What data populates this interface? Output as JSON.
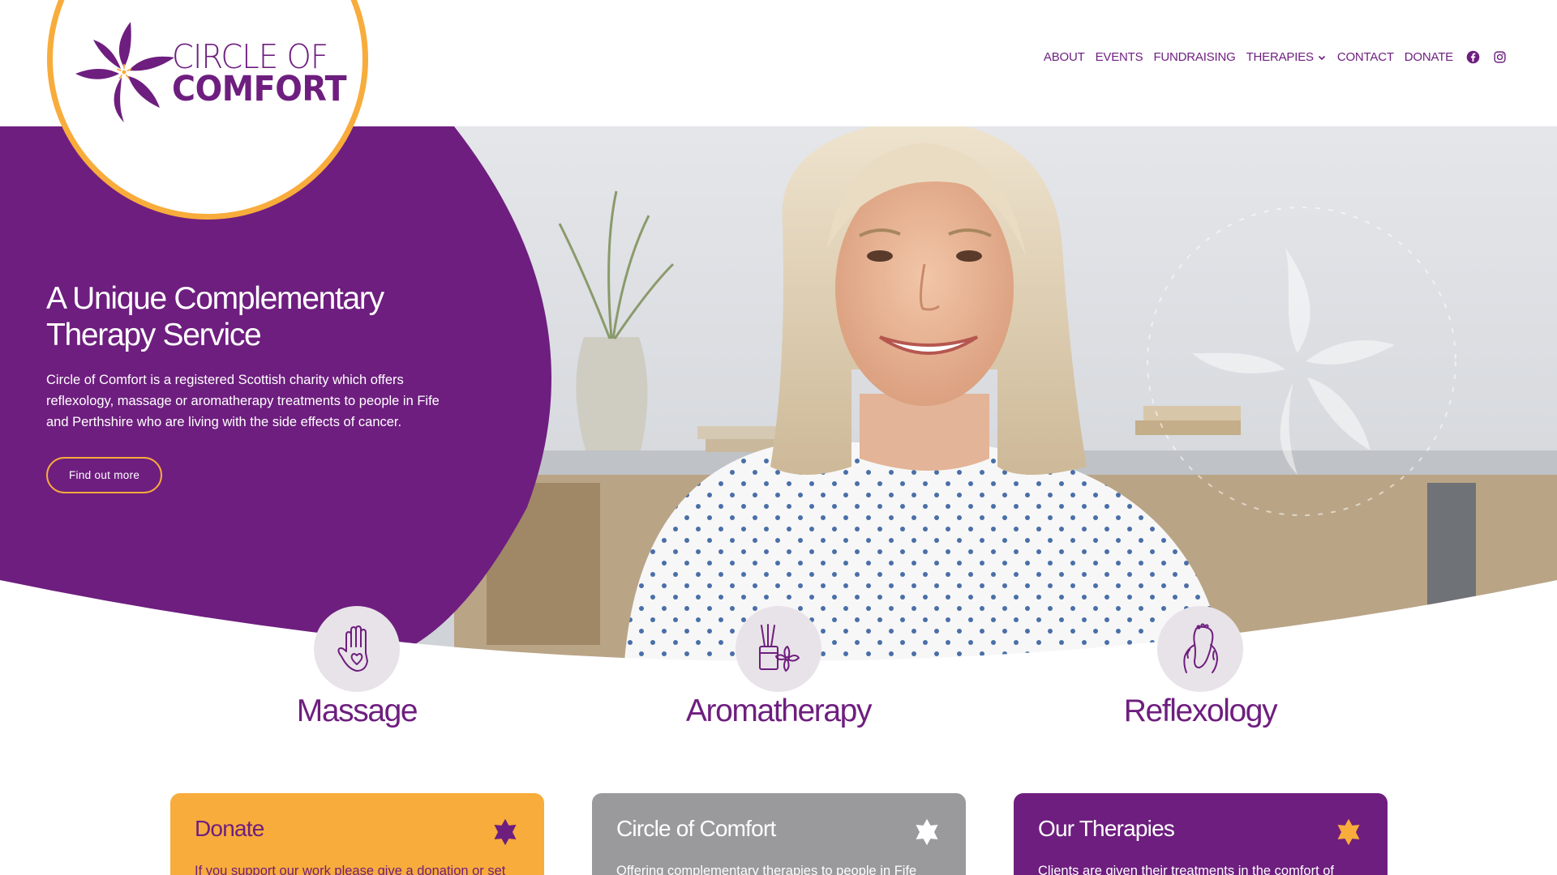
{
  "brand": {
    "line1": "CIRCLE OF",
    "line2": "COMFORT",
    "watermark_text": "CIRCLE OF COMFORT",
    "colors": {
      "purple": "#6e1e7f",
      "orange": "#f8ac3b",
      "grey": "#9a999b"
    }
  },
  "nav": {
    "items": [
      {
        "label": "ABOUT"
      },
      {
        "label": "EVENTS"
      },
      {
        "label": "FUNDRAISING"
      },
      {
        "label": "THERAPIES",
        "has_dropdown": true
      },
      {
        "label": "CONTACT"
      },
      {
        "label": "DONATE"
      }
    ],
    "social": [
      "facebook-icon",
      "instagram-icon"
    ]
  },
  "hero": {
    "title_line1": "A Unique Complementary",
    "title_line2": "Therapy Service",
    "text": "Circle of Comfort is a registered Scottish charity which offers reflexology, massage or aromatherapy treatments to people in Fife and Perthshire who are living with the side effects of cancer.",
    "button_label": "Find out more"
  },
  "therapies": [
    {
      "label": "Massage",
      "icon": "hand-heart-icon"
    },
    {
      "label": "Aromatherapy",
      "icon": "diffuser-flower-icon"
    },
    {
      "label": "Reflexology",
      "icon": "foot-hands-icon"
    }
  ],
  "cards": [
    {
      "title": "Donate",
      "text": "If you support our work please give a donation or set",
      "icon": "star-icon"
    },
    {
      "title": "Circle of Comfort",
      "text": "Offering complementary therapies to people in Fife",
      "icon": "star-icon"
    },
    {
      "title": "Our Therapies",
      "text": "Clients are given their treatments in the comfort of",
      "icon": "star-icon"
    }
  ]
}
